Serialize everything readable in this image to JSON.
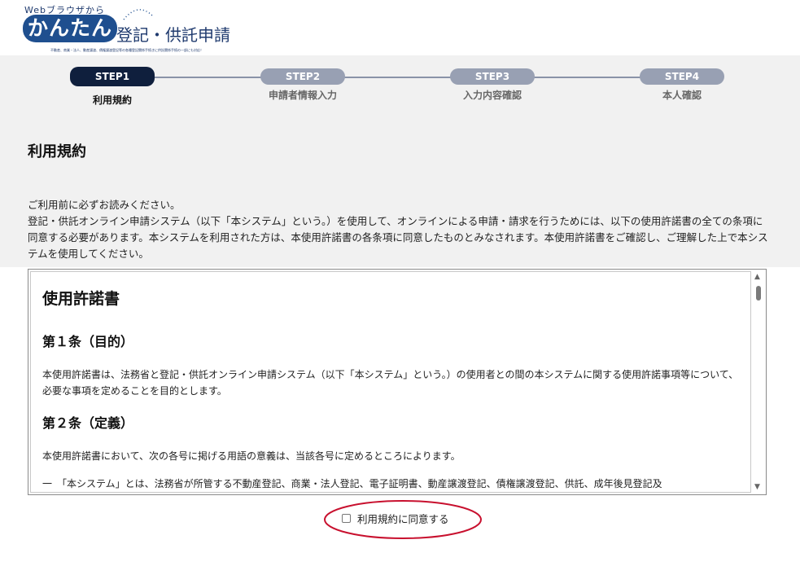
{
  "logo": {
    "top_text": "Webブラウザから",
    "kantan": "かんたん",
    "main_text": "登記・供託申請",
    "sub_text": "不動産、商業・法人、動産譲渡、債権譲渡登記等の各種登記関係手続きに供託関係手続の一部にも対応！"
  },
  "steps": [
    {
      "pill": "STEP1",
      "label": "利用規約",
      "active": true
    },
    {
      "pill": "STEP2",
      "label": "申請者情報入力",
      "active": false
    },
    {
      "pill": "STEP3",
      "label": "入力内容確認",
      "active": false
    },
    {
      "pill": "STEP4",
      "label": "本人確認",
      "active": false
    }
  ],
  "page_title": "利用規約",
  "intro": {
    "line1": "ご利用前に必ずお読みください。",
    "line2": "登記・供託オンライン申請システム（以下「本システム」という。）を使用して、オンラインによる申請・請求を行うためには、以下の使用許諾書の全ての条項に同意する必要があります。本システムを利用された方は、本使用許諾書の各条項に同意したものとみなされます。本使用許諾書をご確認し、ご理解した上で本システムを使用してください。"
  },
  "license": {
    "title": "使用許諾書",
    "article1_title": "第１条（目的）",
    "article1_body": "本使用許諾書は、法務省と登記・供託オンライン申請システム（以下「本システム」という。）の使用者との間の本システムに関する使用許諾事項等について、必要な事項を定めることを目的とします。",
    "article2_title": "第２条（定義）",
    "article2_body": "本使用許諾書において、次の各号に掲げる用語の意義は、当該各号に定めるところによります。",
    "article2_item1": "一　「本システム」とは、法務省が所管する不動産登記、商業・法人登記、電子証明書、動産譲渡登記、債権譲渡登記、供託、成年後見登記及"
  },
  "agree": {
    "label": "利用規約に同意する",
    "checked": false
  },
  "colors": {
    "active_step": "#0f1f3d",
    "inactive_step": "#98a0b3",
    "band": "#f1f1f1",
    "annotation": "#c8102e",
    "logo": "#1f4f8f"
  }
}
